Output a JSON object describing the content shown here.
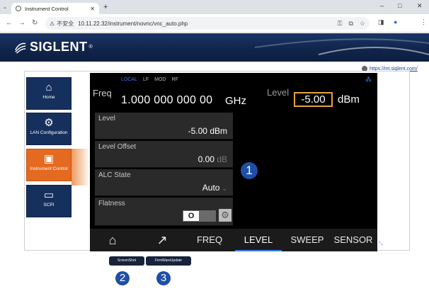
{
  "browser": {
    "tab_title": "Instrument Control",
    "insecure_label": "不安全",
    "url": "10.11.22.32/instrument/novnc/vnc_auto.php"
  },
  "brand": {
    "logo_text": "SIGLENT",
    "logo_mark": "®"
  },
  "help_link": "https://int.siglent.com/",
  "nav": [
    {
      "label": "Home",
      "icon": "home-icon"
    },
    {
      "label": "LAN Configuration",
      "icon": "gear-icon"
    },
    {
      "label": "Instrument Control",
      "icon": "instrument-icon",
      "active": true
    },
    {
      "label": "SCPI",
      "icon": "terminal-icon"
    }
  ],
  "instrument": {
    "status": [
      "LOCAL",
      "LF",
      "MOD",
      "RF"
    ],
    "freq_label": "Freq",
    "freq_value": "1.000 000 000 00",
    "freq_unit": "GHz",
    "level_label": "Level",
    "level_value": "-5.00",
    "level_unit": "dBm",
    "params": [
      {
        "label": "Level",
        "value": "-5.00",
        "unit": "dBm"
      },
      {
        "label": "Level Offset",
        "value": "0.00",
        "unit": "dB"
      },
      {
        "label": "ALC State",
        "value": "Auto"
      },
      {
        "label": "Flatness",
        "toggle": "O"
      }
    ],
    "menu": [
      "FREQ",
      "LEVEL",
      "SWEEP",
      "SENSOR"
    ],
    "active_menu": "LEVEL"
  },
  "buttons": {
    "screenshot": "ScreenShot",
    "firmware": "FirmWareUpdate"
  },
  "callouts": [
    "1",
    "2",
    "3"
  ],
  "colors": {
    "accent": "#1f4fa6",
    "nav_bg": "#16305e",
    "nav_active": "#e36a20",
    "level_box": "#e6a43a"
  }
}
